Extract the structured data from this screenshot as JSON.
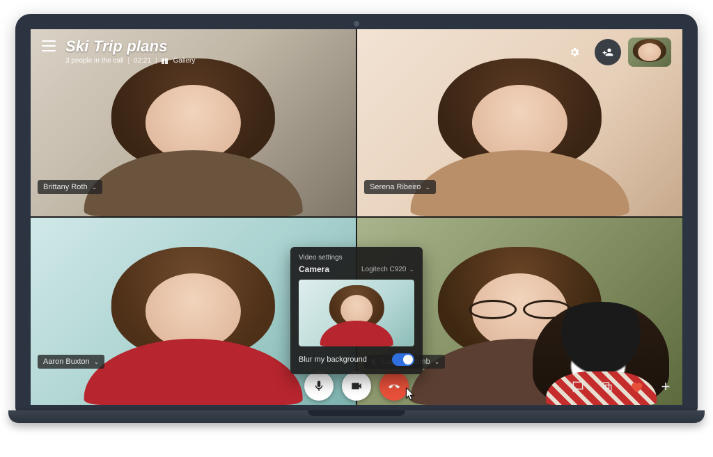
{
  "header": {
    "title": "Ski Trip plans",
    "subtitle_people": "3 people in the call",
    "duration": "02:21",
    "view_label": "Gallery"
  },
  "participants": [
    {
      "name": "Brittany Roth"
    },
    {
      "name": "Serena Ribeiro"
    },
    {
      "name": "Aaron Buxton"
    },
    {
      "name": "Lucy Holcomb",
      "muted": true
    }
  ],
  "video_settings": {
    "panel_title": "Video settings",
    "camera_label": "Camera",
    "camera_device": "Logitech C920",
    "blur_label": "Blur my background",
    "blur_enabled": true
  },
  "icons": {
    "menu": "menu-icon",
    "gear": "gear-icon",
    "add_person": "add-person-icon",
    "mic": "mic-icon",
    "video": "video-icon",
    "hangup": "hangup-icon",
    "chat": "chat-icon",
    "share": "share-screen-icon",
    "heart": "heart-icon",
    "plus": "plus-icon",
    "mic_off": "mic-off-icon",
    "chevron_down": "chevron-down-icon"
  },
  "colors": {
    "hangup": "#e8503a",
    "toggle_on": "#2f6fe0",
    "heart": "#e8503a"
  }
}
